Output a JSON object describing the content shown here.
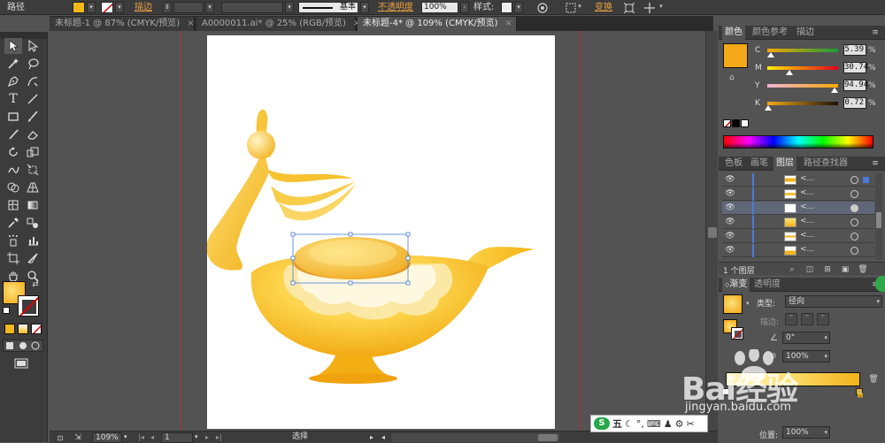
{
  "control_bar": {
    "object_type": "路径",
    "stroke_label": "描边",
    "stroke_profile": "基本",
    "opacity_label": "不透明度",
    "opacity_value": "100%",
    "style_label": "样式",
    "transform_label": "变换"
  },
  "tabs": [
    {
      "label": "未标题-1 @ 87% (CMYK/预览)",
      "close": "×"
    },
    {
      "label": "A0000011.ai* @ 25% (RGB/预览)",
      "close": "×"
    },
    {
      "label": "未标题-4* @ 109% (CMYK/预览)",
      "close": "×",
      "active": true
    }
  ],
  "status_bar": {
    "zoom": "109%",
    "page": "1",
    "tool_status": "选择"
  },
  "color_panel": {
    "tabs": [
      "颜色",
      "颜色参考",
      "描边"
    ],
    "swatch_color": "#f5a818",
    "sliders": [
      {
        "label": "C",
        "value": "5.39",
        "unit": "%",
        "fraction": 0.054
      },
      {
        "label": "M",
        "value": "30.74",
        "unit": "%",
        "fraction": 0.307
      },
      {
        "label": "Y",
        "value": "94.94",
        "unit": "%",
        "fraction": 0.949
      },
      {
        "label": "K",
        "value": "0.72",
        "unit": "%",
        "fraction": 0.007
      }
    ]
  },
  "layers_panel": {
    "tabs": [
      "色板",
      "画笔",
      "图层",
      "路径查找器"
    ],
    "rows": [
      {
        "name": "<...",
        "selected": false
      },
      {
        "name": "<...",
        "selected": false
      },
      {
        "name": "<...",
        "selected": true
      },
      {
        "name": "<...",
        "selected": false
      },
      {
        "name": "<...",
        "selected": false
      },
      {
        "name": "<...",
        "selected": false
      }
    ],
    "footer": "1 个图层"
  },
  "gradient_panel": {
    "tabs": [
      "渐变",
      "透明度"
    ],
    "type_label": "类型:",
    "type_value": "径向",
    "stroke_label": "描边:",
    "angle_value": "0°",
    "ratio_value": "100%",
    "position_label": "位置:",
    "position_value": "100%"
  },
  "ime": {
    "label": "五"
  },
  "watermark": {
    "brand": "Bai经验",
    "url": "jingyan.baidu.com"
  },
  "colors": {
    "accent_orange": "#e8a040",
    "lamp_gold": "#f5b81c",
    "layer_blue": "#4b7bd8"
  }
}
